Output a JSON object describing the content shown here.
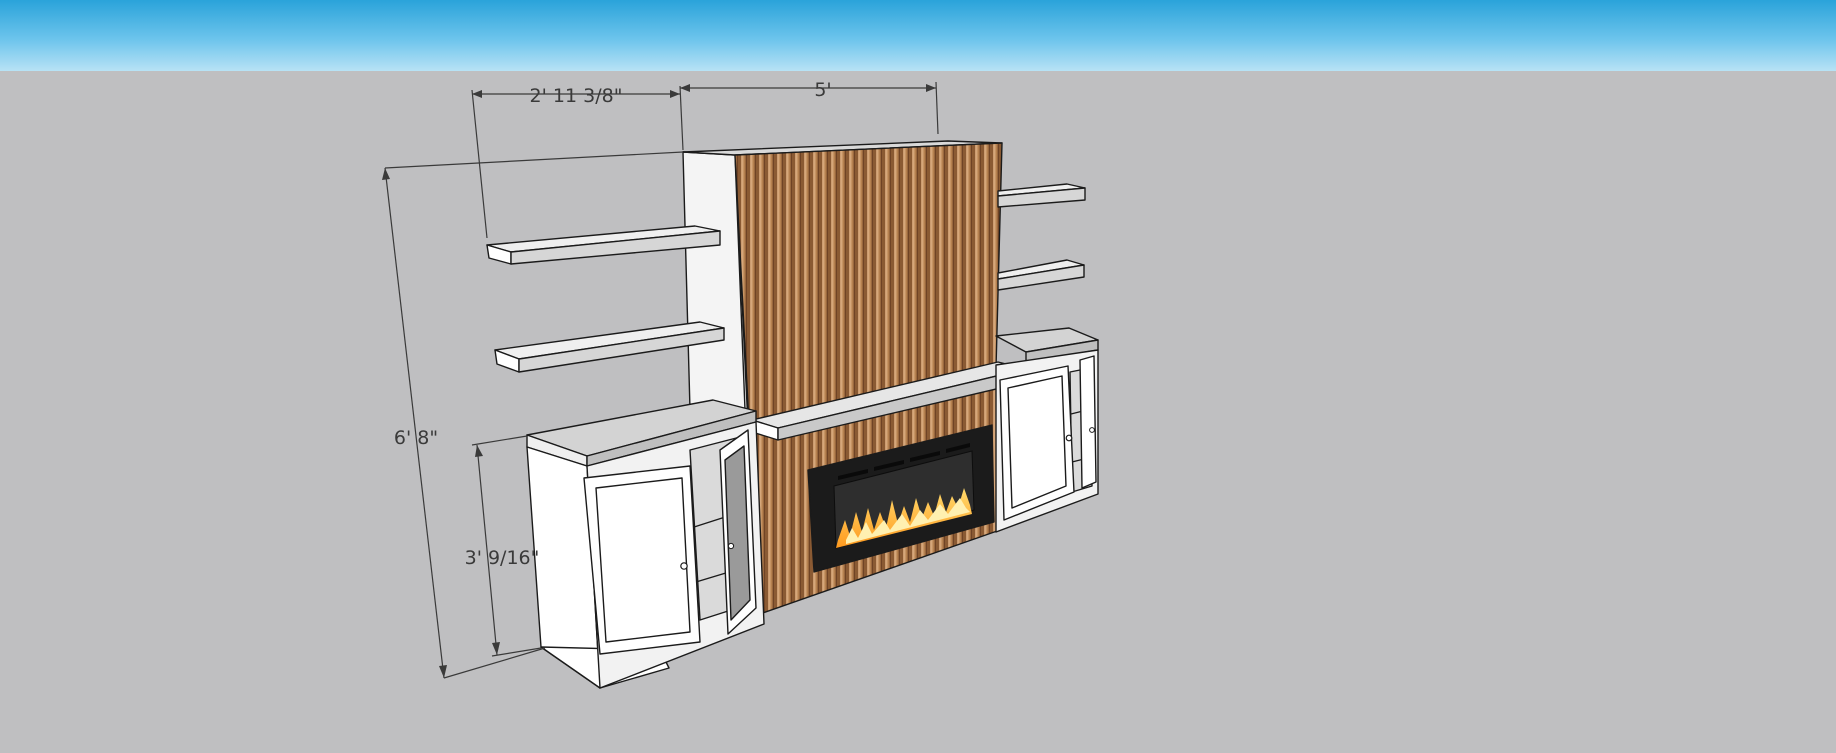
{
  "model": {
    "dimensions": {
      "left_width": "2' 11 3/8\"",
      "center_width": "5'",
      "total_height": "6' 8\"",
      "cabinet_height": "3' 9/16\""
    },
    "colors": {
      "sky_top": "#2aa3da",
      "ground": "#bfbfc1",
      "wood": "#b07a4f",
      "cabinet_white": "#ffffff",
      "fireplace": "#1a1a1a",
      "flame": "#f2a33a"
    }
  }
}
